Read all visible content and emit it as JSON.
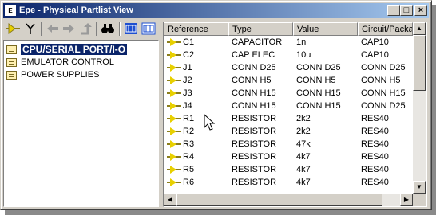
{
  "window": {
    "title": "Epe - Physical Partlist View",
    "icon": "epe-app-icon"
  },
  "caption_buttons": {
    "minimize": "_",
    "maximize": "□",
    "close": "×"
  },
  "toolbar": {
    "buttons": [
      {
        "name": "component-view-icon"
      },
      {
        "name": "net-view-icon"
      },
      {
        "name": "back-arrow-icon"
      },
      {
        "name": "forward-arrow-icon"
      },
      {
        "name": "up-arrow-icon"
      },
      {
        "name": "binoculars-find-icon"
      },
      {
        "name": "schematic-view-icon"
      },
      {
        "name": "pcb-view-icon"
      }
    ]
  },
  "tree": {
    "items": [
      {
        "label": "CPU/SERIAL PORT/I-O",
        "selected": true
      },
      {
        "label": "EMULATOR CONTROL",
        "selected": false
      },
      {
        "label": "POWER SUPPLIES",
        "selected": false
      }
    ]
  },
  "table": {
    "columns": [
      "Reference",
      "Type",
      "Value",
      "Circuit/Package"
    ],
    "rows": [
      [
        "C1",
        "CAPACITOR",
        "1n",
        "CAP10"
      ],
      [
        "C2",
        "CAP ELEC",
        "10u",
        "CAP10"
      ],
      [
        "J1",
        "CONN D25",
        "CONN D25",
        "CONN D25"
      ],
      [
        "J2",
        "CONN H5",
        "CONN H5",
        "CONN H5"
      ],
      [
        "J3",
        "CONN H15",
        "CONN H15",
        "CONN H15"
      ],
      [
        "J4",
        "CONN H15",
        "CONN H15",
        "CONN D25"
      ],
      [
        "R1",
        "RESISTOR",
        "2k2",
        "RES40"
      ],
      [
        "R2",
        "RESISTOR",
        "2k2",
        "RES40"
      ],
      [
        "R3",
        "RESISTOR",
        "47k",
        "RES40"
      ],
      [
        "R4",
        "RESISTOR",
        "4k7",
        "RES40"
      ],
      [
        "R5",
        "RESISTOR",
        "4k7",
        "RES40"
      ],
      [
        "R6",
        "RESISTOR",
        "4k7",
        "RES40"
      ]
    ]
  },
  "colors": {
    "title_gradient_start": "#0a246a",
    "title_gradient_end": "#a6caf0",
    "selection": "#0a246a",
    "face": "#d4d0c8"
  }
}
